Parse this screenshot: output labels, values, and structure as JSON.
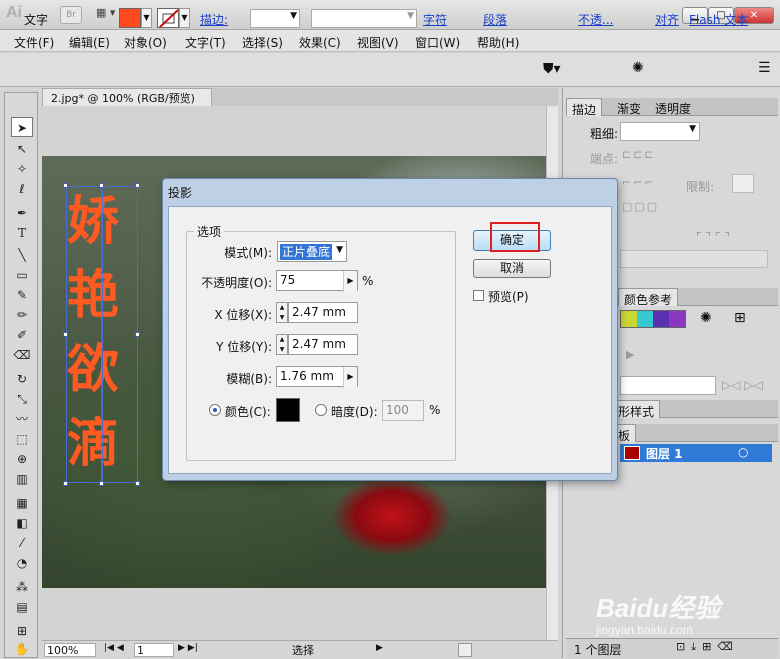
{
  "app": {
    "logo": "Ai",
    "bridge": "Br"
  },
  "window": {
    "min": "▁",
    "max": "□",
    "close": "✕"
  },
  "menu": [
    "文件(F)",
    "编辑(E)",
    "对象(O)",
    "文字(T)",
    "选择(S)",
    "效果(C)",
    "视图(V)",
    "窗口(W)",
    "帮助(H)"
  ],
  "control": {
    "tool_label": "文字",
    "stroke_label": "描边:",
    "char_link": "字符",
    "para_link": "段落",
    "opacity_link": "不透...",
    "align_link": "对齐",
    "flash_link": "Flash 文本",
    "fill_color": "#ff4a1e"
  },
  "document": {
    "tab": "2.jpg* @ 100% (RGB/预览)",
    "zoom": "100%",
    "page": "1",
    "status": "选择",
    "art_glyphs_col1": [
      "娇",
      "艳",
      "欲",
      "滴"
    ]
  },
  "panels": {
    "top_tabs": [
      "描边",
      "渐变",
      "透明度"
    ],
    "weight_label": "粗细:",
    "cap_label": "端点:",
    "limit_label": "限制:",
    "color_ref_tab": "颜色参考",
    "graphic_styles_tab": "形样式",
    "layers_tab": "板",
    "layer_name": "图层 1",
    "layer_count": "1 个图层"
  },
  "dialog": {
    "title": "投影",
    "group": "选项",
    "mode_label": "模式(M):",
    "mode_value": "正片叠底",
    "opacity_label": "不透明度(O):",
    "opacity_value": "75",
    "percent": "%",
    "xoff_label": "X 位移(X):",
    "xoff_value": "2.47 mm",
    "yoff_label": "Y 位移(Y):",
    "yoff_value": "2.47 mm",
    "blur_label": "模糊(B):",
    "blur_value": "1.76 mm",
    "color_label": "颜色(C):",
    "darkness_label": "暗度(D):",
    "darkness_value": "100",
    "shadow_color": "#000000",
    "ok": "确定",
    "cancel": "取消",
    "preview": "预览(P)"
  },
  "watermark": {
    "logo": "Baidu经验",
    "url": "jingyan.baidu.com"
  }
}
